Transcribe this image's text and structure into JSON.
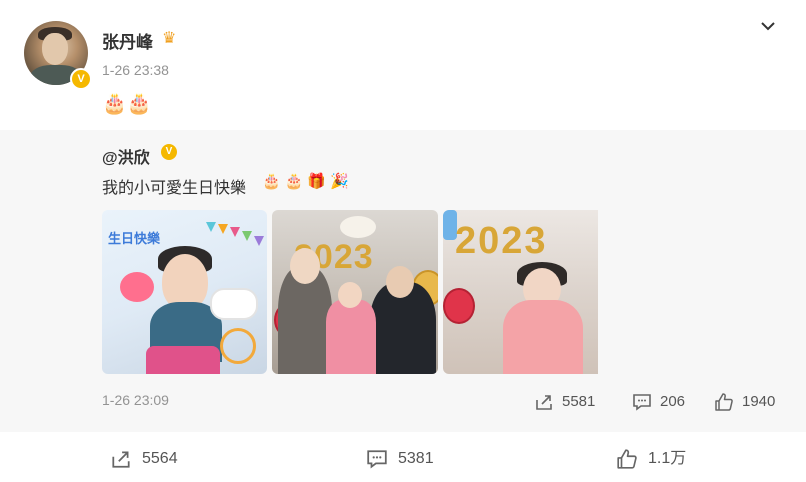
{
  "post": {
    "author": "张丹峰",
    "timestamp": "1-26 23:38",
    "text": "🎂🎂",
    "author_badge_icon": "crown-icon",
    "verified_icon": "verified-badge-icon",
    "menu_icon": "chevron-down-icon"
  },
  "repost": {
    "author": "@洪欣",
    "text": "我的小可愛生日快樂",
    "emoji": "🎂🎂🎁🎉",
    "timestamp": "1-26 23:09",
    "photo1_title": "生日快樂",
    "photo2_number": "2023",
    "photo3_number": "2023",
    "actions": {
      "share_count": "5581",
      "comment_count": "206",
      "like_count": "1940"
    }
  },
  "footer": {
    "share_count": "5564",
    "comment_count": "5381",
    "like_count": "1.1万"
  },
  "colors": {
    "verified": "#f5b800",
    "meta_text": "#939393",
    "repost_bg": "#f7f7f7"
  }
}
